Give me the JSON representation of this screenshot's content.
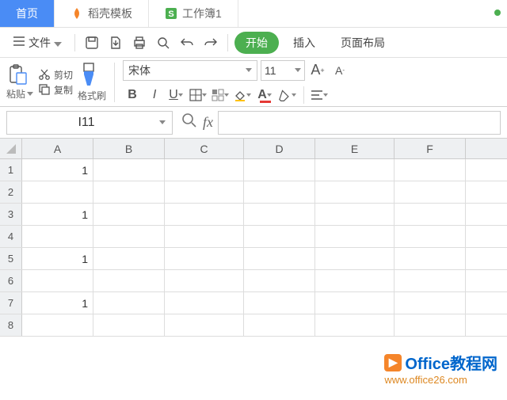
{
  "tabs": {
    "home": "首页",
    "template": "稻壳模板",
    "workbook": "工作簿1"
  },
  "toolbar": {
    "file": "文件",
    "start": "开始",
    "insert": "插入",
    "layout": "页面布局"
  },
  "ribbon": {
    "paste": "粘贴",
    "cut": "剪切",
    "copy": "复制",
    "fmtbrush": "格式刷",
    "font": "宋体",
    "size": "11",
    "bold": "B",
    "italic": "I",
    "underline": "U"
  },
  "namebox": "I11",
  "fx_label": "fx",
  "cols": [
    "A",
    "B",
    "C",
    "D",
    "E",
    "F"
  ],
  "rows": [
    "1",
    "2",
    "3",
    "4",
    "5",
    "6",
    "7",
    "8"
  ],
  "cells": {
    "A1": "1",
    "A3": "1",
    "A5": "1",
    "A7": "1"
  },
  "watermark": {
    "title": "Office教程网",
    "url": "www.office26.com"
  }
}
